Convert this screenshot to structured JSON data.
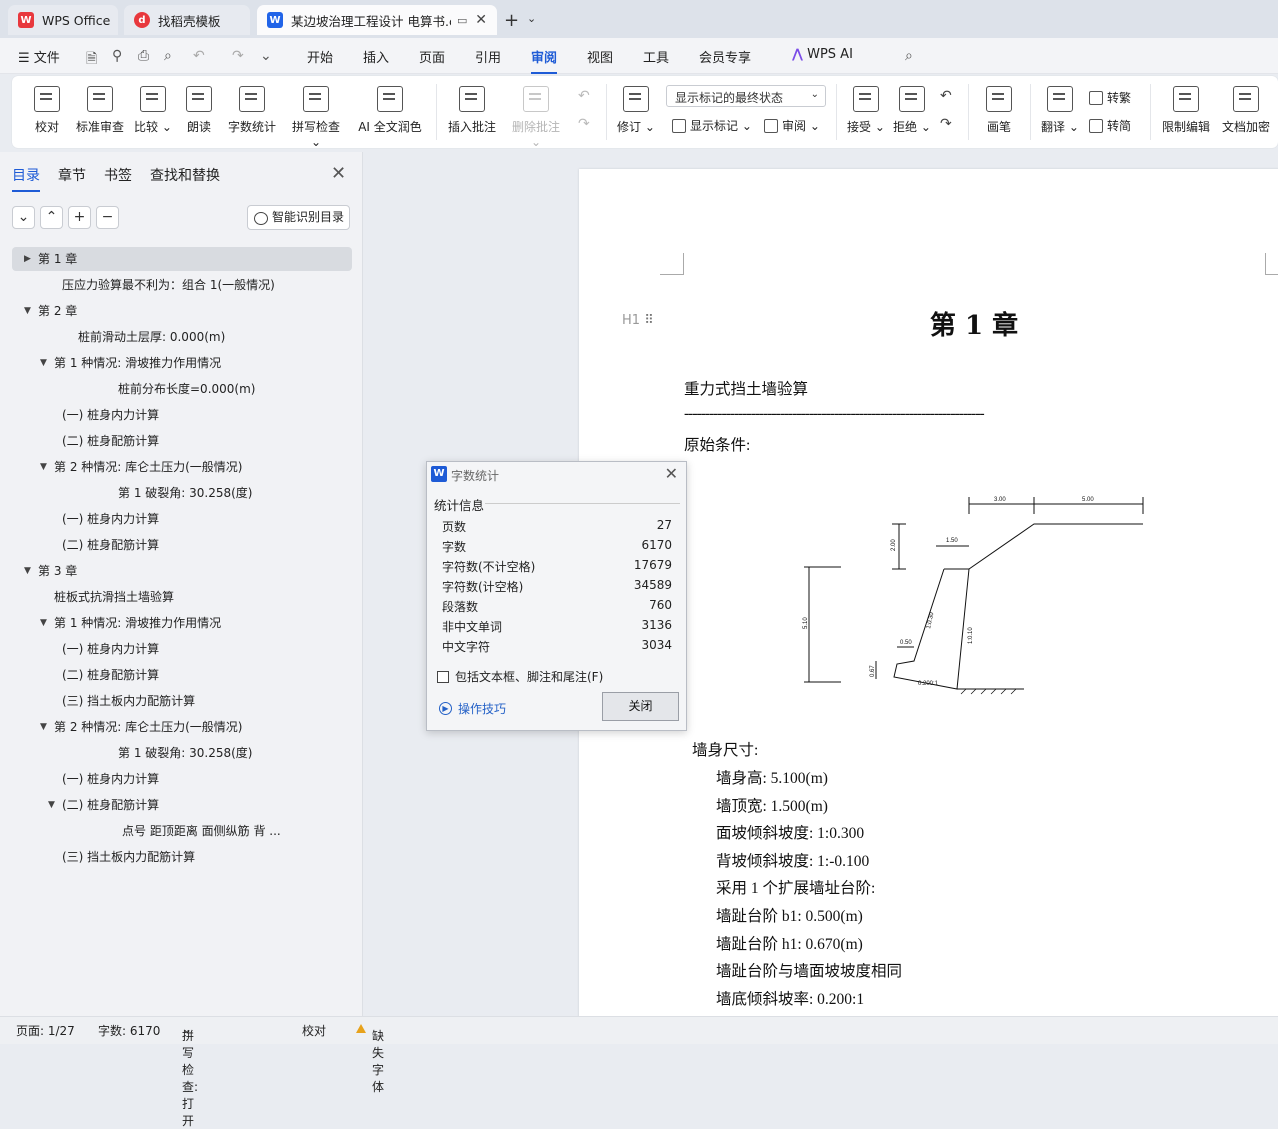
{
  "tabs": [
    {
      "label": "WPS Office",
      "icon": "wps-logo-icon"
    },
    {
      "label": "找稻壳模板",
      "icon": "docer-icon"
    },
    {
      "label": "某边坡治理工程设计 电算书.c",
      "icon": "writer-doc-icon"
    }
  ],
  "menu": {
    "file": "文件",
    "items": [
      "开始",
      "插入",
      "页面",
      "引用",
      "审阅",
      "视图",
      "工具",
      "会员专享"
    ],
    "active": "审阅",
    "ai": "WPS AI"
  },
  "ribbon": {
    "proofread": "校对",
    "std_review": "标准审查",
    "compare": "比较",
    "read_aloud": "朗读",
    "word_count": "字数统计",
    "spell_check": "拼写检查",
    "ai_polish": "AI 全文润色",
    "insert_comment": "插入批注",
    "delete_comment": "删除批注",
    "revise": "修订",
    "markup_select": "显示标记的最终状态",
    "show_markup": "显示标记",
    "review": "审阅",
    "accept": "接受",
    "reject": "拒绝",
    "pen": "画笔",
    "translate": "翻译",
    "to_traditional": "转繁",
    "to_simplified": "转简",
    "restrict_edit": "限制编辑",
    "encrypt": "文档加密"
  },
  "nav": {
    "tabs": [
      "目录",
      "章节",
      "书签",
      "查找和替换"
    ],
    "smart_toc": "智能识别目录",
    "items": [
      {
        "text": "第 1 章",
        "level": 0,
        "arrow": "▶",
        "selected": true
      },
      {
        "text": "压应力验算最不利为：组合 1(一般情况)",
        "level": 2,
        "arrow": ""
      },
      {
        "text": "第 2 章",
        "level": 0,
        "arrow": "▼"
      },
      {
        "text": "桩前滑动土层厚: 0.000(m)",
        "level": 3,
        "arrow": ""
      },
      {
        "text": "第 1 种情况:   滑坡推力作用情况",
        "level": 1,
        "arrow": "▼"
      },
      {
        "text": "桩前分布长度=0.000(m)",
        "level": 4,
        "arrow": ""
      },
      {
        "text": "(一) 桩身内力计算",
        "level": 2,
        "arrow": ""
      },
      {
        "text": "(二) 桩身配筋计算",
        "level": 2,
        "arrow": ""
      },
      {
        "text": "第 2 种情况:   库仑土压力(一般情况)",
        "level": 1,
        "arrow": "▼"
      },
      {
        "text": "第 1 破裂角:    30.258(度)",
        "level": 4,
        "arrow": ""
      },
      {
        "text": "(一) 桩身内力计算",
        "level": 2,
        "arrow": ""
      },
      {
        "text": "(二) 桩身配筋计算",
        "level": 2,
        "arrow": ""
      },
      {
        "text": "第 3 章",
        "level": 0,
        "arrow": "▼"
      },
      {
        "text": "桩板式抗滑挡土墙验算",
        "level": 1,
        "arrow": ""
      },
      {
        "text": "第 1 种情况:   滑坡推力作用情况",
        "level": 1,
        "arrow": "▼"
      },
      {
        "text": "(一) 桩身内力计算",
        "level": 2,
        "arrow": ""
      },
      {
        "text": "(二) 桩身配筋计算",
        "level": 2,
        "arrow": ""
      },
      {
        "text": "(三) 挡土板内力配筋计算",
        "level": 2,
        "arrow": ""
      },
      {
        "text": "第 2 种情况:   库仑土压力(一般情况)",
        "level": 1,
        "arrow": "▼"
      },
      {
        "text": "第 1 破裂角:    30.258(度)",
        "level": 4,
        "arrow": ""
      },
      {
        "text": "(一) 桩身内力计算",
        "level": 2,
        "arrow": ""
      },
      {
        "text": "(二) 桩身配筋计算",
        "level": 2,
        "arrow": "▼"
      },
      {
        "text": "点号       距顶距离       面侧纵筋     背 ...",
        "level": 5,
        "arrow": ""
      },
      {
        "text": "(三) 挡土板内力配筋计算",
        "level": 2,
        "arrow": ""
      }
    ]
  },
  "document": {
    "heading_marker": "H1",
    "chapter_title": "第 1 章",
    "lines": [
      "重力式挡土墙验算",
      "------------------------------------------------------------------------",
      "原始条件:"
    ],
    "figure_dims": [
      "3.00",
      "5.00",
      "1.50",
      "2.00",
      "5.10",
      "0.50",
      "1:0.30",
      "1:0.10",
      "0.67",
      "0.200:1"
    ],
    "wall_title": "墙身尺寸:",
    "wall_lines": [
      "墙身高: 5.100(m)",
      "墙顶宽: 1.500(m)",
      "面坡倾斜坡度: 1:0.300",
      "背坡倾斜坡度: 1:-0.100",
      "采用 1 个扩展墙址台阶:",
      "墙趾台阶 b1: 0.500(m)",
      "墙趾台阶 h1: 0.670(m)",
      "墙趾台阶与墙面坡坡度相同",
      "墙底倾斜坡率: 0.200:1"
    ]
  },
  "dialog": {
    "title": "字数统计",
    "section": "统计信息",
    "rows": [
      {
        "label": "页数",
        "value": "27"
      },
      {
        "label": "字数",
        "value": "6170"
      },
      {
        "label": "字符数(不计空格)",
        "value": "17679"
      },
      {
        "label": "字符数(计空格)",
        "value": "34589"
      },
      {
        "label": "段落数",
        "value": "760"
      },
      {
        "label": "非中文单词",
        "value": "3136"
      },
      {
        "label": "中文字符",
        "value": "3034"
      }
    ],
    "checkbox": "包括文本框、脚注和尾注(F)",
    "tips": "操作技巧",
    "close": "关闭"
  },
  "status": {
    "page": "页面: 1/27",
    "words": "字数: 6170",
    "spell": "拼写检查: 打开",
    "proof": "校对",
    "font_warn": "缺失字体"
  },
  "colors": {
    "accent": "#1e5bd6",
    "wps_red": "#e8383d",
    "writer_blue": "#2164e8"
  }
}
